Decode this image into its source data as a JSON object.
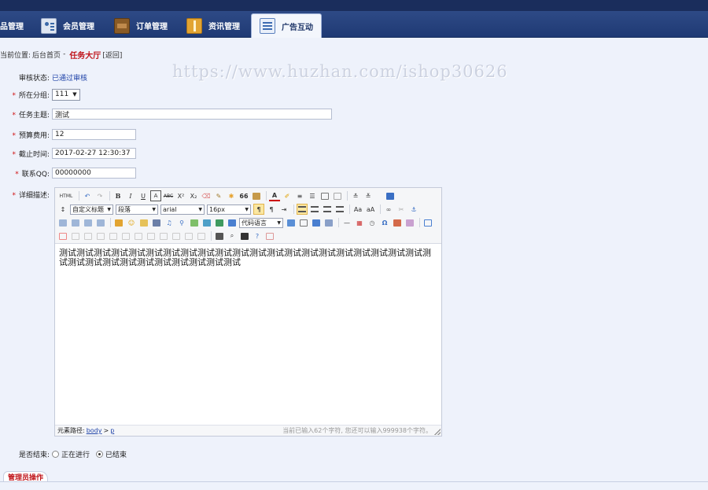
{
  "nav": {
    "tabs": [
      {
        "label": "品管理",
        "icon": ""
      },
      {
        "label": "会员管理",
        "icon": "member-card-icon"
      },
      {
        "label": "订单管理",
        "icon": "wallet-icon"
      },
      {
        "label": "资讯管理",
        "icon": "book-icon"
      },
      {
        "label": "广告互动",
        "icon": "list-document-icon",
        "active": true
      }
    ]
  },
  "breadcrumb": {
    "prefix": "当前位置:",
    "home": "后台首页",
    "sep": "-",
    "current": "任务大厅",
    "back": "[返回]"
  },
  "watermark": "https://www.huzhan.com/ishop30626",
  "form": {
    "status": {
      "label": "审核状态:",
      "value": "已通过审核"
    },
    "category": {
      "label": "所在分组:",
      "value": "111"
    },
    "subject": {
      "label": "任务主题:",
      "value": "测试"
    },
    "budget": {
      "label": "预算费用:",
      "value": "12"
    },
    "deadline": {
      "label": "截止时间:",
      "value": "2017-02-27 12:30:37"
    },
    "qq": {
      "label": "联系QQ:",
      "value": "00000000"
    },
    "detail": {
      "label": "详细描述:"
    },
    "finished": {
      "label": "是否结束:",
      "options": [
        "正在进行",
        "已结束"
      ],
      "selected": "已结束"
    },
    "required_mark": "*"
  },
  "editor": {
    "toolbar": {
      "html": "HTML",
      "bold": "B",
      "italic": "I",
      "underline": "U",
      "font_border": "A",
      "strike": "ABC",
      "superscript": "X²",
      "subscript": "X₂",
      "quote": "66",
      "fore_color": "A",
      "custom_title": "自定义标题",
      "paragraph": "段落",
      "font_family": "arial",
      "font_size": "16px",
      "code_language": "代码语言",
      "omega": "Ω"
    },
    "content": "测试测试测试测试测试测试测试测试测试测试测试测试测试测试测试测试测试测试测试测试测试测试测试测试测试测试测试测试测试测试测试测试",
    "statusbar": {
      "path_label": "元素路径:",
      "path_body": "body",
      "path_sep": ">",
      "path_p": "p",
      "count": "当前已输入62个字符, 您还可以输入999938个字符。"
    }
  },
  "footer_tab": "管理员操作",
  "colors": {
    "nav_bg": "#1f3a74",
    "page_bg": "#eef2fb",
    "accent_red": "#c0161c",
    "link_blue": "#1f43a8"
  }
}
